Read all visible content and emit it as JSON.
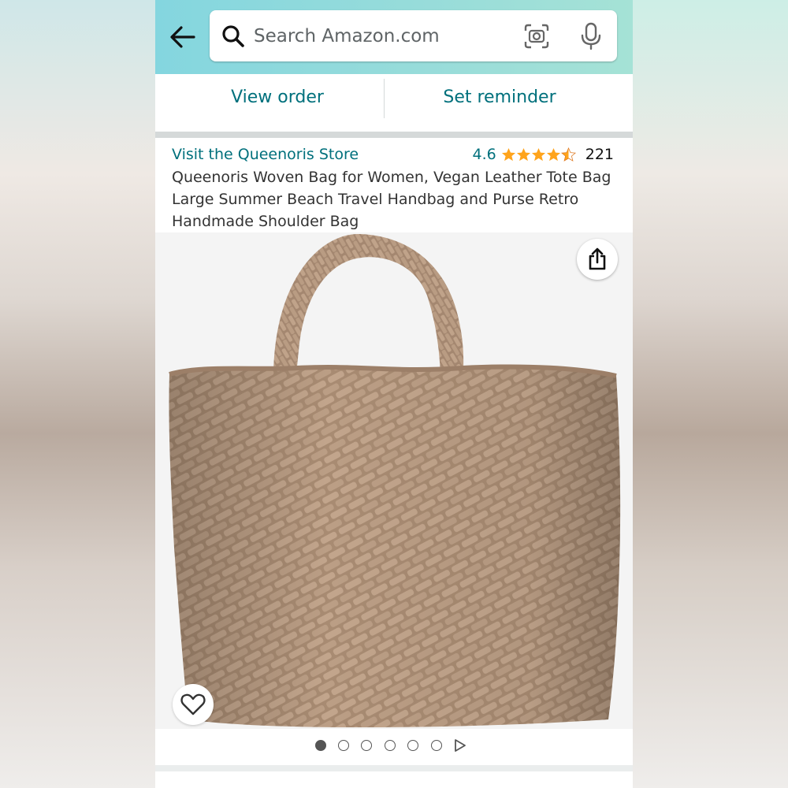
{
  "search": {
    "placeholder": "Search Amazon.com"
  },
  "actions": {
    "view_order": "View order",
    "set_reminder": "Set reminder"
  },
  "product": {
    "store_link": "Visit the Queenoris Store",
    "rating_value": "4.6",
    "stars": 4.5,
    "review_count": "221",
    "title": "Queenoris Woven Bag for Women, Vegan Leather Tote Bag Large Summer Beach Travel Handbag and Purse Retro Handmade Shoulder Bag"
  },
  "gallery": {
    "image_count": 6,
    "active_index": 0,
    "has_video": true
  },
  "colors": {
    "header_start": "#84d6df",
    "header_end": "#a5e2d6",
    "link": "#00707c",
    "star": "#ffa41c",
    "bag": "#b79a82"
  },
  "icons": [
    "back-arrow-icon",
    "search-icon",
    "camera-lens-icon",
    "microphone-icon",
    "share-icon",
    "heart-icon",
    "play-icon"
  ]
}
